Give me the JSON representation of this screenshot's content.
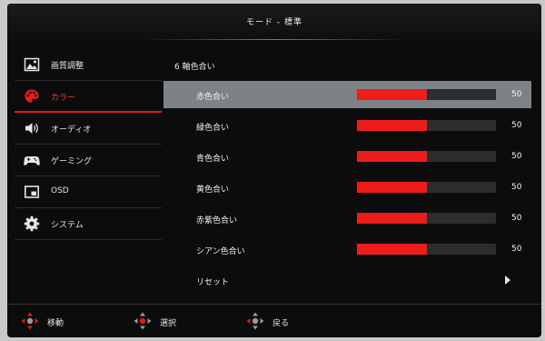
{
  "header": {
    "title": "モード - 標準"
  },
  "sidebar": {
    "items": [
      {
        "label": "画質調整",
        "icon": "picture-icon"
      },
      {
        "label": "カラー",
        "icon": "palette-icon",
        "active": true
      },
      {
        "label": "オーディオ",
        "icon": "speaker-icon"
      },
      {
        "label": "ゲーミング",
        "icon": "gamepad-icon"
      },
      {
        "label": "OSD",
        "icon": "osd-window-icon"
      },
      {
        "label": "システム",
        "icon": "gear-icon"
      }
    ]
  },
  "main": {
    "title": "6 軸色合い",
    "rows": [
      {
        "label": "赤色合い",
        "value": "50",
        "level": 0.5
      },
      {
        "label": "緑色合い",
        "value": "50",
        "level": 0.5
      },
      {
        "label": "青色合い",
        "value": "50",
        "level": 0.5
      },
      {
        "label": "黄色合い",
        "value": "50",
        "level": 0.5
      },
      {
        "label": "赤紫色合い",
        "value": "50",
        "level": 0.5
      },
      {
        "label": "シアン色合い",
        "value": "50",
        "level": 0.5
      }
    ],
    "reset_label": "リセット"
  },
  "footer": {
    "move_label": "移動",
    "select_label": "選択",
    "back_label": "戻る"
  },
  "colors": {
    "accent": "#ef1c1c",
    "selected_row": "#7d8286",
    "background": "#0c0c0c"
  }
}
